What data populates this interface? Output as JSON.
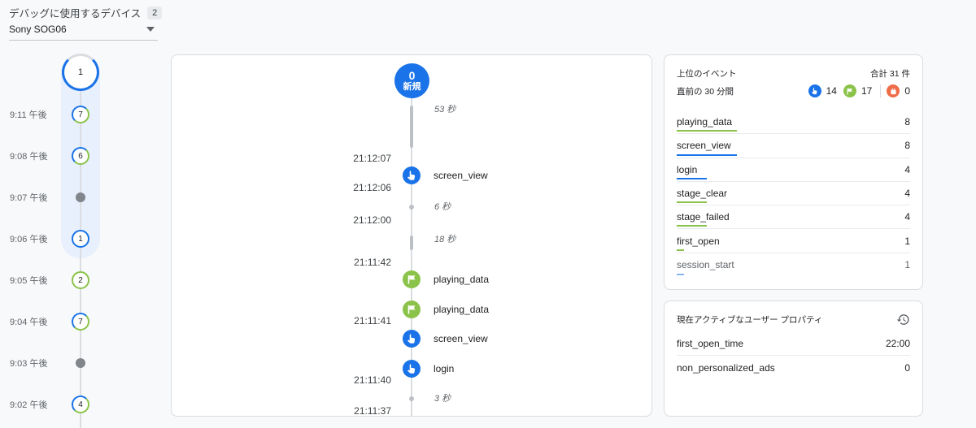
{
  "device": {
    "label": "デバッグに使用するデバイス",
    "count": "2",
    "selected": "Sony SOG06"
  },
  "minutes": {
    "current": "1",
    "items": [
      {
        "time": "9:11 午後",
        "count": "7",
        "kind": "mixed"
      },
      {
        "time": "9:08 午後",
        "count": "6",
        "kind": "mixed"
      },
      {
        "time": "9:07 午後",
        "count": "",
        "kind": "dot"
      },
      {
        "time": "9:06 午後",
        "count": "1",
        "kind": "blue"
      },
      {
        "time": "9:05 午後",
        "count": "2",
        "kind": "green"
      },
      {
        "time": "9:04 午後",
        "count": "7",
        "kind": "mixed"
      },
      {
        "time": "9:03 午後",
        "count": "",
        "kind": "dot"
      },
      {
        "time": "9:02 午後",
        "count": "4",
        "kind": "mixed"
      }
    ]
  },
  "stream": {
    "new_count": "0",
    "new_label": "新規",
    "gaps": [
      "53 秒",
      "6 秒",
      "18 秒",
      "3 秒"
    ],
    "timestamps": [
      "21:12:07",
      "21:12:06",
      "21:12:00",
      "21:11:42",
      "21:11:41",
      "21:11:40",
      "21:11:37"
    ],
    "events": [
      {
        "name": "screen_view",
        "icon": "touch-icon"
      },
      {
        "name": "playing_data",
        "icon": "flag-icon"
      },
      {
        "name": "playing_data",
        "icon": "flag-icon"
      },
      {
        "name": "screen_view",
        "icon": "touch-icon"
      },
      {
        "name": "login",
        "icon": "touch-icon"
      }
    ]
  },
  "top_events": {
    "title": "上位のイベント",
    "total": "合計 31 件",
    "period": "直前の 30 分間",
    "counts": {
      "blue": "14",
      "green": "17",
      "orange": "0"
    },
    "rows": [
      {
        "name": "playing_data",
        "value": "8"
      },
      {
        "name": "screen_view",
        "value": "8"
      },
      {
        "name": "login",
        "value": "4"
      },
      {
        "name": "stage_clear",
        "value": "4"
      },
      {
        "name": "stage_failed",
        "value": "4"
      },
      {
        "name": "first_open",
        "value": "1"
      },
      {
        "name": "session_start",
        "value": "1"
      }
    ]
  },
  "user_props": {
    "title": "現在アクティブなユーザー プロパティ",
    "rows": [
      {
        "name": "first_open_time",
        "value": "22:00"
      },
      {
        "name": "non_personalized_ads",
        "value": "0"
      }
    ]
  },
  "colors": {
    "blue": "#1a73e8",
    "green": "#8bc34a",
    "orange": "#ef6c47",
    "grey": "#80868b"
  }
}
